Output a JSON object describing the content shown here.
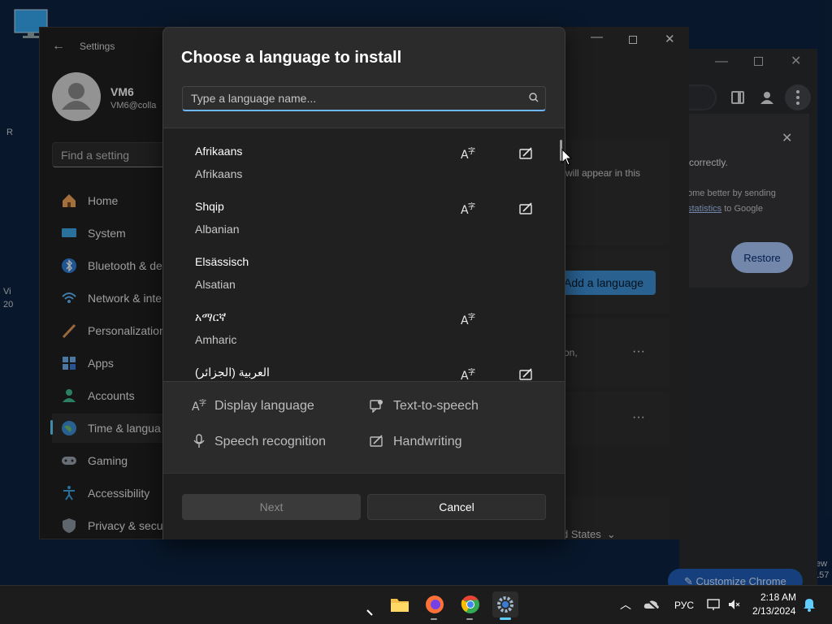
{
  "desktop": {
    "edge_left_1": "R",
    "edge_left_2": "Vi",
    "edge_left_3": "20",
    "edge_right_1": "ew",
    "edge_right_2": "157"
  },
  "chrome": {
    "popup_line1": "correctly.",
    "popup_line2": "ome better by sending",
    "popup_link": "statistics",
    "popup_line3": " to Google",
    "restore_label": "Restore",
    "customize_label": "Customize Chrome"
  },
  "settings": {
    "title": "Settings",
    "user_name": "VM6",
    "user_email": "VM6@colla",
    "search_placeholder": "Find a setting",
    "nav": [
      {
        "label": "Home",
        "icon": "home-icon"
      },
      {
        "label": "System",
        "icon": "system-icon"
      },
      {
        "label": "Bluetooth & de",
        "icon": "bluetooth-icon"
      },
      {
        "label": "Network & inte",
        "icon": "network-icon"
      },
      {
        "label": "Personalization",
        "icon": "personalization-icon"
      },
      {
        "label": "Apps",
        "icon": "apps-icon"
      },
      {
        "label": "Accounts",
        "icon": "accounts-icon"
      },
      {
        "label": "Time & langua",
        "icon": "time-language-icon"
      },
      {
        "label": "Gaming",
        "icon": "gaming-icon"
      },
      {
        "label": "Accessibility",
        "icon": "accessibility-icon"
      },
      {
        "label": "Privacy & secu",
        "icon": "privacy-icon"
      }
    ],
    "right_text1": "will appear in this",
    "add_language_label": "Add a language",
    "right_text2": "on,",
    "region_value": "d States"
  },
  "dialog": {
    "title": "Choose a language to install",
    "search_placeholder": "Type a language name...",
    "languages": [
      {
        "name": "Afrikaans",
        "english": "Afrikaans",
        "display": true,
        "handwriting": true
      },
      {
        "name": "Shqip",
        "english": "Albanian",
        "display": true,
        "handwriting": true
      },
      {
        "name": "Elsässisch",
        "english": "Alsatian",
        "display": false,
        "handwriting": false
      },
      {
        "name": "አማርኛ",
        "english": "Amharic",
        "display": true,
        "handwriting": false
      },
      {
        "name": "العربية (الجزائر)",
        "english": "",
        "display": true,
        "handwriting": true
      }
    ],
    "legend": {
      "display": "Display language",
      "tts": "Text-to-speech",
      "speech": "Speech recognition",
      "handwriting": "Handwriting"
    },
    "next_label": "Next",
    "cancel_label": "Cancel"
  },
  "taskbar": {
    "lang_indicator": "РУС",
    "time": "2:18 AM",
    "date": "2/13/2024"
  },
  "colors": {
    "accent": "#60cdff",
    "add_button": "#3d8fd6",
    "restore": "#a8c7fa"
  }
}
